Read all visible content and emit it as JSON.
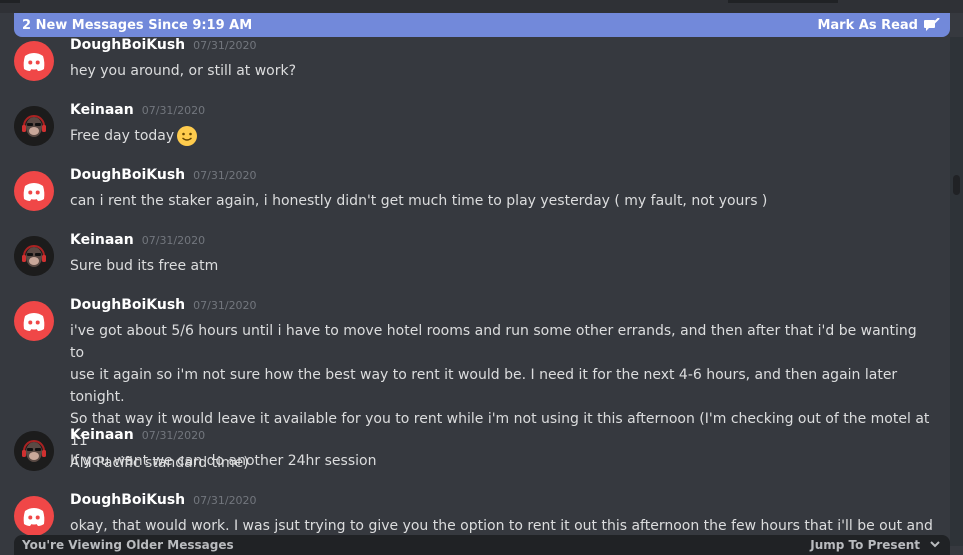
{
  "new_messages_bar": {
    "text": "2 New Messages Since 9:19 AM",
    "action": "Mark As Read",
    "action_icon": "mark-read-icon",
    "color": "#7289da"
  },
  "messages": [
    {
      "author": "DoughBoiKush",
      "timestamp": "07/31/2020",
      "avatar": "discord-logo-icon",
      "text": "hey you around, or still at work?"
    },
    {
      "author": "Keinaan",
      "timestamp": "07/31/2020",
      "avatar": "monkey-headphones-avatar",
      "text": "Free day today",
      "emoji": "slightly-smiling-face-icon"
    },
    {
      "author": "DoughBoiKush",
      "timestamp": "07/31/2020",
      "avatar": "discord-logo-icon",
      "text": "can i rent the staker again, i honestly didn't get much time to play yesterday ( my fault, not yours )"
    },
    {
      "author": "Keinaan",
      "timestamp": "07/31/2020",
      "avatar": "monkey-headphones-avatar",
      "text": "Sure bud its free atm"
    },
    {
      "author": "DoughBoiKush",
      "timestamp": "07/31/2020",
      "avatar": "discord-logo-icon",
      "lines": [
        "i've got about 5/6 hours until i have to move hotel rooms and run some other errands, and then after that i'd be wanting to",
        "use it again so i'm not sure how the best way to rent it would be. I need it for the next 4-6 hours, and then again later tonight.",
        "So that way it would leave it available for you to rent while i'm not using it this afternoon (I'm checking out of the motel at 11",
        "AM Pacific standard time)"
      ]
    },
    {
      "author": "Keinaan",
      "timestamp": "07/31/2020",
      "avatar": "monkey-headphones-avatar",
      "text": "If you want we can do another 24hr session"
    },
    {
      "author": "DoughBoiKush",
      "timestamp": "07/31/2020",
      "avatar": "discord-logo-icon",
      "text": "okay, that would work. I was jsut trying to give you the option to rent it out this afternoon the few hours that i'll be out and"
    }
  ],
  "bottom_bar": {
    "text": "You're Viewing Older Messages",
    "action": "Jump To Present"
  },
  "colors": {
    "background": "#36393f",
    "discord_red": "#f04747",
    "timestamp": "#72767d"
  }
}
